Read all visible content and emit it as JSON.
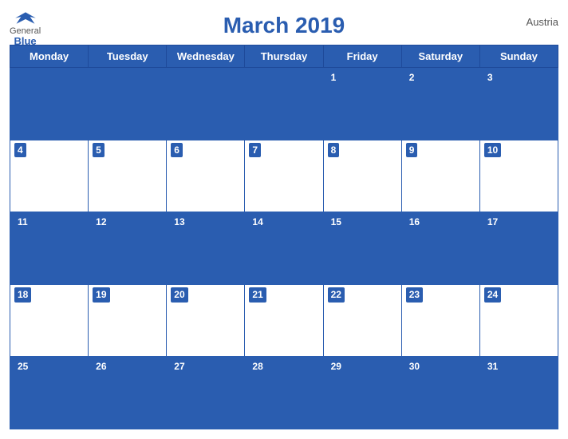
{
  "header": {
    "logo": {
      "general": "General",
      "blue": "Blue",
      "bird_unicode": "🐦"
    },
    "title": "March 2019",
    "country": "Austria"
  },
  "calendar": {
    "days_of_week": [
      "Monday",
      "Tuesday",
      "Wednesday",
      "Thursday",
      "Friday",
      "Saturday",
      "Sunday"
    ],
    "weeks": [
      [
        null,
        null,
        null,
        null,
        1,
        2,
        3
      ],
      [
        4,
        5,
        6,
        7,
        8,
        9,
        10
      ],
      [
        11,
        12,
        13,
        14,
        15,
        16,
        17
      ],
      [
        18,
        19,
        20,
        21,
        22,
        23,
        24
      ],
      [
        25,
        26,
        27,
        28,
        29,
        30,
        31
      ]
    ]
  }
}
